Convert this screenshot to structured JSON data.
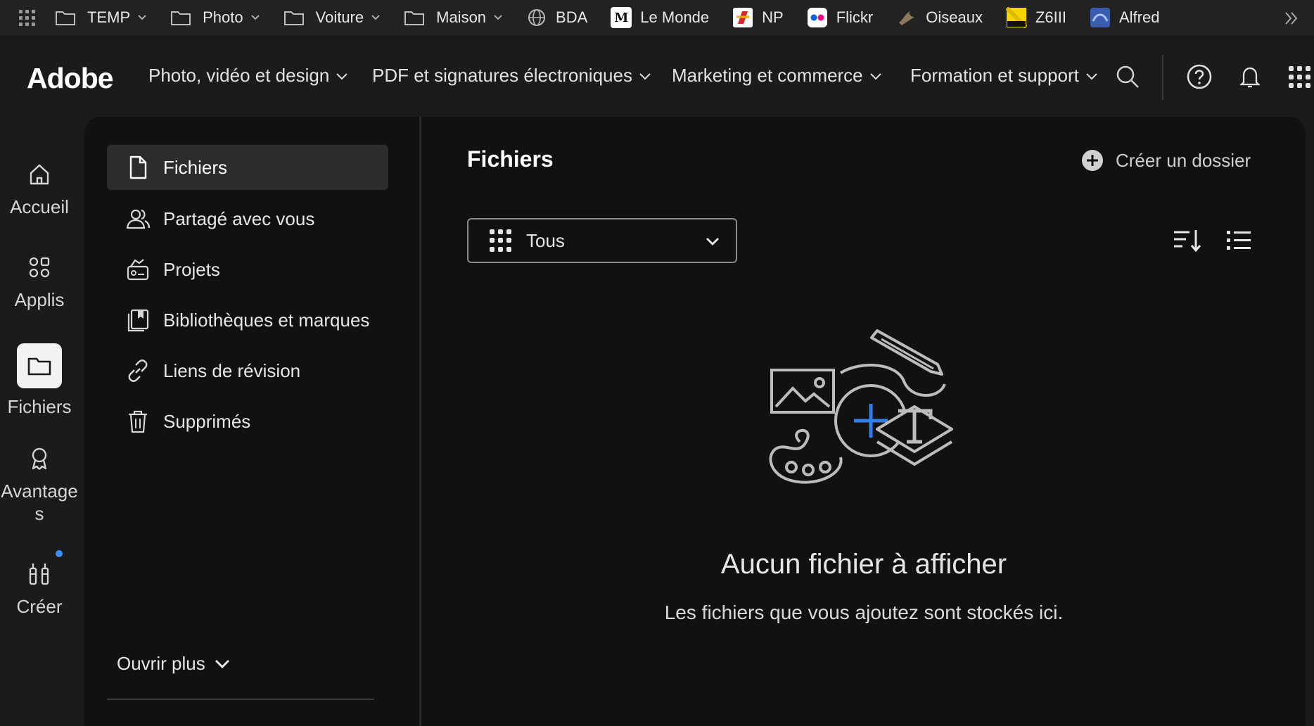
{
  "bookmarks": {
    "items": [
      {
        "label": "TEMP",
        "icon": "folder-icon"
      },
      {
        "label": "Photo",
        "icon": "folder-icon"
      },
      {
        "label": "Voiture",
        "icon": "folder-icon"
      },
      {
        "label": "Maison",
        "icon": "folder-icon"
      },
      {
        "label": "BDA",
        "icon": "globe-icon"
      },
      {
        "label": "Le Monde",
        "icon": "lemonde-icon",
        "glyph": "M"
      },
      {
        "label": "NP",
        "icon": "np-icon"
      },
      {
        "label": "Flickr",
        "icon": "flickr-icon"
      },
      {
        "label": "Oiseaux",
        "icon": "bird-icon"
      },
      {
        "label": "Z6III",
        "icon": "nikon-icon"
      },
      {
        "label": "Alfred",
        "icon": "alfred-icon"
      }
    ]
  },
  "header": {
    "logo": "Adobe",
    "nav": [
      "Photo, vidéo et design",
      "PDF et signatures électroniques",
      "Marketing et commerce",
      "Formation et support"
    ]
  },
  "rail": {
    "items": [
      {
        "label": "Accueil",
        "icon": "home-icon"
      },
      {
        "label": "Applis",
        "icon": "apps-icon"
      },
      {
        "label": "Fichiers",
        "icon": "folder-icon",
        "active": true
      },
      {
        "label": "Avantages",
        "icon": "award-icon"
      },
      {
        "label": "Créer",
        "icon": "create-icon"
      }
    ]
  },
  "sidenav": {
    "items": [
      {
        "label": "Fichiers",
        "icon": "file-icon",
        "active": true
      },
      {
        "label": "Partagé avec vous",
        "icon": "users-icon"
      },
      {
        "label": "Projets",
        "icon": "projects-icon"
      },
      {
        "label": "Bibliothèques et marques",
        "icon": "library-icon"
      },
      {
        "label": "Liens de révision",
        "icon": "link-icon"
      },
      {
        "label": "Supprimés",
        "icon": "trash-icon"
      }
    ],
    "open_more": "Ouvrir plus"
  },
  "main": {
    "title": "Fichiers",
    "create_folder": "Créer un dossier",
    "filter_value": "Tous",
    "empty_title": "Aucun fichier à afficher",
    "empty_subtitle": "Les fichiers que vous ajoutez sont stockés ici."
  },
  "colors": {
    "accent_blue": "#3b8ef5",
    "background": "#111111"
  }
}
